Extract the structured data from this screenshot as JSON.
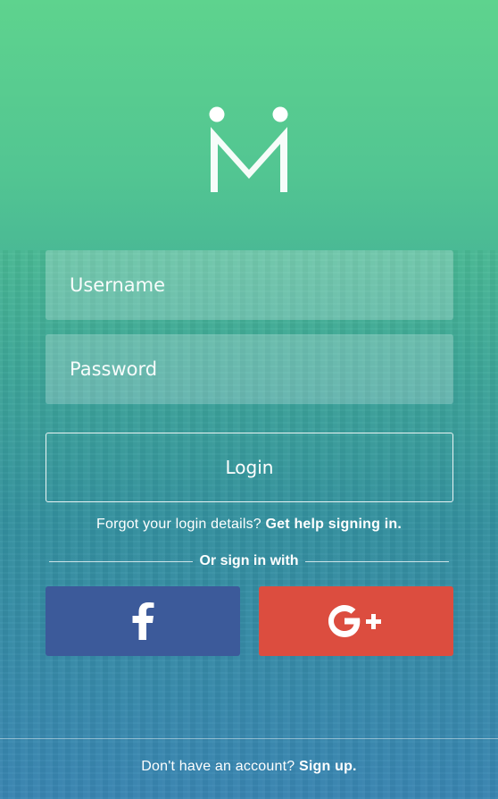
{
  "app": {
    "logo_name": "m-logo"
  },
  "form": {
    "username_placeholder": "Username",
    "password_placeholder": "Password",
    "login_label": "Login"
  },
  "forgot": {
    "text": "Forgot your login details?",
    "link": "Get help signing in."
  },
  "social": {
    "divider_label": "Or sign in with",
    "facebook_icon": "facebook-icon",
    "google_icon": "google-plus-icon",
    "facebook_color": "#3c5a9a",
    "google_color": "#dc4d3f"
  },
  "footer": {
    "text": "Don't have an account?",
    "link": "Sign up."
  }
}
